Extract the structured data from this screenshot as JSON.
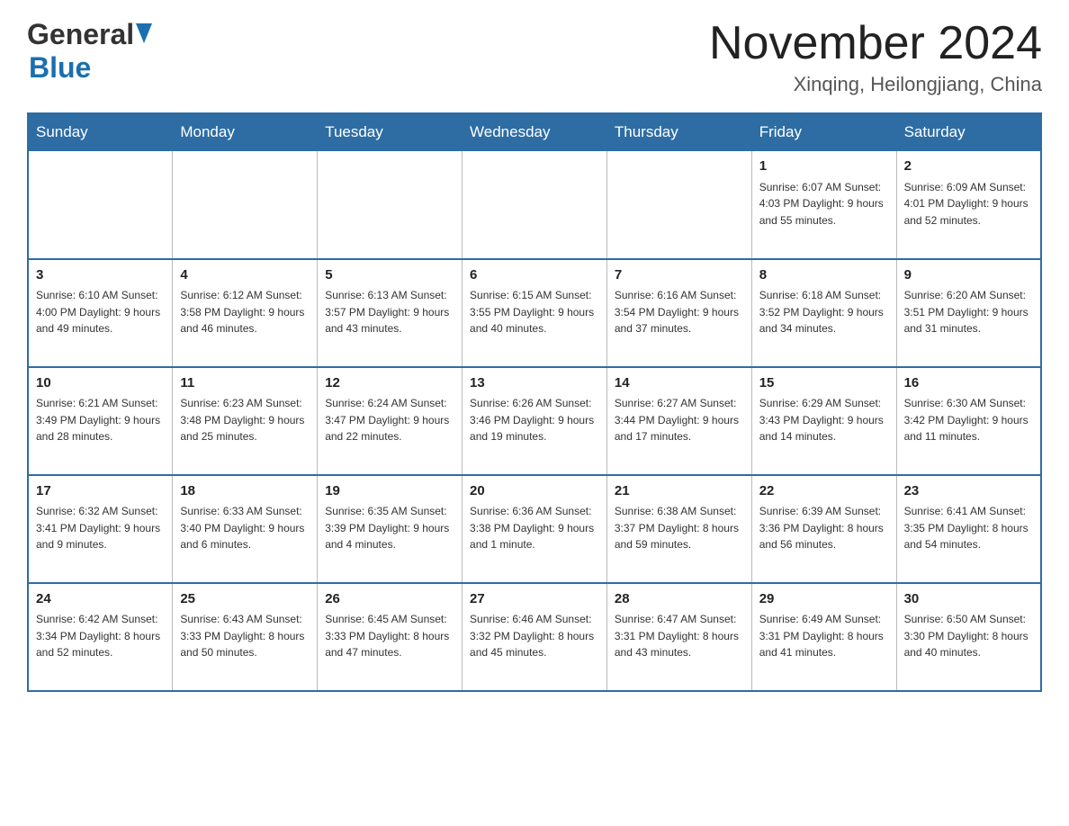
{
  "header": {
    "logo_general": "General",
    "logo_blue": "Blue",
    "title": "November 2024",
    "subtitle": "Xinqing, Heilongjiang, China"
  },
  "columns": [
    "Sunday",
    "Monday",
    "Tuesday",
    "Wednesday",
    "Thursday",
    "Friday",
    "Saturday"
  ],
  "weeks": [
    [
      {
        "day": "",
        "info": ""
      },
      {
        "day": "",
        "info": ""
      },
      {
        "day": "",
        "info": ""
      },
      {
        "day": "",
        "info": ""
      },
      {
        "day": "",
        "info": ""
      },
      {
        "day": "1",
        "info": "Sunrise: 6:07 AM\nSunset: 4:03 PM\nDaylight: 9 hours\nand 55 minutes."
      },
      {
        "day": "2",
        "info": "Sunrise: 6:09 AM\nSunset: 4:01 PM\nDaylight: 9 hours\nand 52 minutes."
      }
    ],
    [
      {
        "day": "3",
        "info": "Sunrise: 6:10 AM\nSunset: 4:00 PM\nDaylight: 9 hours\nand 49 minutes."
      },
      {
        "day": "4",
        "info": "Sunrise: 6:12 AM\nSunset: 3:58 PM\nDaylight: 9 hours\nand 46 minutes."
      },
      {
        "day": "5",
        "info": "Sunrise: 6:13 AM\nSunset: 3:57 PM\nDaylight: 9 hours\nand 43 minutes."
      },
      {
        "day": "6",
        "info": "Sunrise: 6:15 AM\nSunset: 3:55 PM\nDaylight: 9 hours\nand 40 minutes."
      },
      {
        "day": "7",
        "info": "Sunrise: 6:16 AM\nSunset: 3:54 PM\nDaylight: 9 hours\nand 37 minutes."
      },
      {
        "day": "8",
        "info": "Sunrise: 6:18 AM\nSunset: 3:52 PM\nDaylight: 9 hours\nand 34 minutes."
      },
      {
        "day": "9",
        "info": "Sunrise: 6:20 AM\nSunset: 3:51 PM\nDaylight: 9 hours\nand 31 minutes."
      }
    ],
    [
      {
        "day": "10",
        "info": "Sunrise: 6:21 AM\nSunset: 3:49 PM\nDaylight: 9 hours\nand 28 minutes."
      },
      {
        "day": "11",
        "info": "Sunrise: 6:23 AM\nSunset: 3:48 PM\nDaylight: 9 hours\nand 25 minutes."
      },
      {
        "day": "12",
        "info": "Sunrise: 6:24 AM\nSunset: 3:47 PM\nDaylight: 9 hours\nand 22 minutes."
      },
      {
        "day": "13",
        "info": "Sunrise: 6:26 AM\nSunset: 3:46 PM\nDaylight: 9 hours\nand 19 minutes."
      },
      {
        "day": "14",
        "info": "Sunrise: 6:27 AM\nSunset: 3:44 PM\nDaylight: 9 hours\nand 17 minutes."
      },
      {
        "day": "15",
        "info": "Sunrise: 6:29 AM\nSunset: 3:43 PM\nDaylight: 9 hours\nand 14 minutes."
      },
      {
        "day": "16",
        "info": "Sunrise: 6:30 AM\nSunset: 3:42 PM\nDaylight: 9 hours\nand 11 minutes."
      }
    ],
    [
      {
        "day": "17",
        "info": "Sunrise: 6:32 AM\nSunset: 3:41 PM\nDaylight: 9 hours\nand 9 minutes."
      },
      {
        "day": "18",
        "info": "Sunrise: 6:33 AM\nSunset: 3:40 PM\nDaylight: 9 hours\nand 6 minutes."
      },
      {
        "day": "19",
        "info": "Sunrise: 6:35 AM\nSunset: 3:39 PM\nDaylight: 9 hours\nand 4 minutes."
      },
      {
        "day": "20",
        "info": "Sunrise: 6:36 AM\nSunset: 3:38 PM\nDaylight: 9 hours\nand 1 minute."
      },
      {
        "day": "21",
        "info": "Sunrise: 6:38 AM\nSunset: 3:37 PM\nDaylight: 8 hours\nand 59 minutes."
      },
      {
        "day": "22",
        "info": "Sunrise: 6:39 AM\nSunset: 3:36 PM\nDaylight: 8 hours\nand 56 minutes."
      },
      {
        "day": "23",
        "info": "Sunrise: 6:41 AM\nSunset: 3:35 PM\nDaylight: 8 hours\nand 54 minutes."
      }
    ],
    [
      {
        "day": "24",
        "info": "Sunrise: 6:42 AM\nSunset: 3:34 PM\nDaylight: 8 hours\nand 52 minutes."
      },
      {
        "day": "25",
        "info": "Sunrise: 6:43 AM\nSunset: 3:33 PM\nDaylight: 8 hours\nand 50 minutes."
      },
      {
        "day": "26",
        "info": "Sunrise: 6:45 AM\nSunset: 3:33 PM\nDaylight: 8 hours\nand 47 minutes."
      },
      {
        "day": "27",
        "info": "Sunrise: 6:46 AM\nSunset: 3:32 PM\nDaylight: 8 hours\nand 45 minutes."
      },
      {
        "day": "28",
        "info": "Sunrise: 6:47 AM\nSunset: 3:31 PM\nDaylight: 8 hours\nand 43 minutes."
      },
      {
        "day": "29",
        "info": "Sunrise: 6:49 AM\nSunset: 3:31 PM\nDaylight: 8 hours\nand 41 minutes."
      },
      {
        "day": "30",
        "info": "Sunrise: 6:50 AM\nSunset: 3:30 PM\nDaylight: 8 hours\nand 40 minutes."
      }
    ]
  ]
}
